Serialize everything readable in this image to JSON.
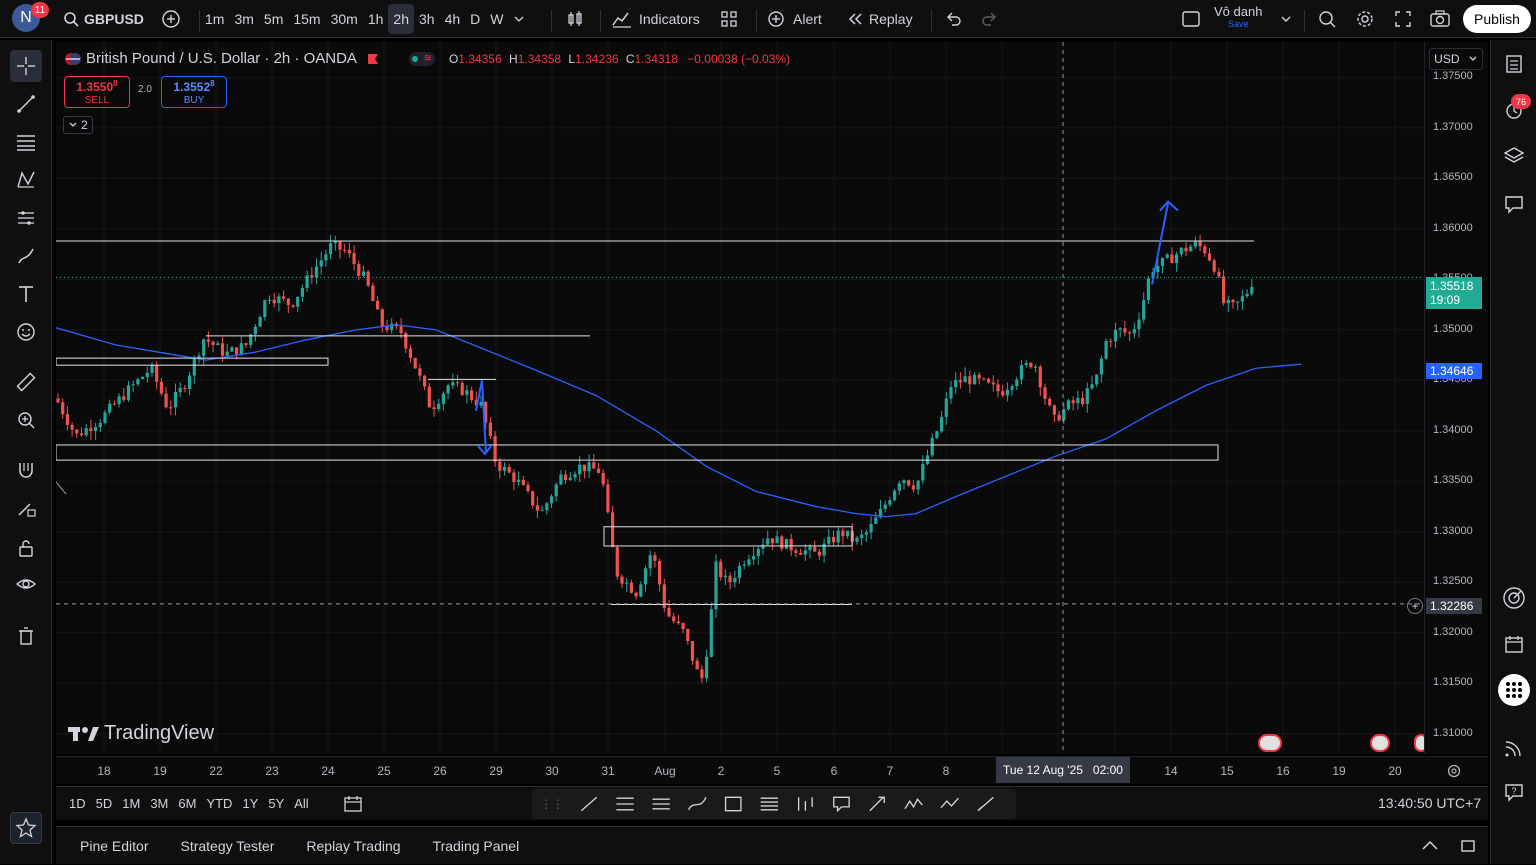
{
  "topbar": {
    "user_initial": "N",
    "notif_count": "11",
    "symbol": "GBPUSD",
    "intervals": [
      "1m",
      "3m",
      "5m",
      "15m",
      "30m",
      "1h",
      "2h",
      "3h",
      "4h",
      "D",
      "W"
    ],
    "active_interval": "2h",
    "indicators": "Indicators",
    "alert": "Alert",
    "replay": "Replay",
    "layout_name": "Vô danh",
    "layout_save": "Save",
    "publish": "Publish"
  },
  "legend": {
    "title": "British Pound / U.S. Dollar · 2h · OANDA",
    "o_label": "O",
    "o": "1.34356",
    "h_label": "H",
    "h": "1.34358",
    "l_label": "L",
    "l": "1.34236",
    "c_label": "C",
    "c": "1.34318",
    "change": "−0.00038 (−0.03%)",
    "sell_price": "1.3550",
    "sell_sup": "8",
    "sell_label": "SELL",
    "spread": "2.0",
    "buy_price": "1.3552",
    "buy_sup": "8",
    "buy_label": "BUY",
    "collapse": "2"
  },
  "price_scale": {
    "currency": "USD",
    "labels": [
      "1.37500",
      "1.37000",
      "1.36500",
      "1.36000",
      "1.35500",
      "1.35000",
      "1.34500",
      "1.34000",
      "1.33500",
      "1.33000",
      "1.32500",
      "1.32000",
      "1.31500",
      "1.31000"
    ],
    "last_price": "1.35518",
    "countdown": "19:09",
    "ma_price": "1.34646",
    "crosshair_price": "1.32286"
  },
  "time_scale": {
    "labels": [
      "18",
      "19",
      "22",
      "23",
      "24",
      "25",
      "26",
      "29",
      "30",
      "31",
      "Aug",
      "2",
      "5",
      "6",
      "7",
      "8",
      "14",
      "15",
      "16",
      "19",
      "20"
    ],
    "crosshair_time": "Tue 12 Aug '25   02:00"
  },
  "chart_data": {
    "type": "candlestick",
    "symbol": "GBPUSD",
    "interval": "2h",
    "y_range": [
      1.308,
      1.3785
    ],
    "moving_average_last": 1.34646,
    "last_price": 1.35518,
    "crosshair_price": 1.32286,
    "horizontal_zones": [
      [
        1.3588,
        1.3588
      ],
      [
        1.3472,
        1.3465
      ],
      [
        1.3494,
        1.3494
      ],
      [
        1.3386,
        1.3371
      ],
      [
        1.3305,
        1.3286
      ]
    ]
  },
  "watermark": "TradingView",
  "bottom": {
    "ranges": [
      "1D",
      "5D",
      "1M",
      "3M",
      "6M",
      "YTD",
      "1Y",
      "5Y",
      "All"
    ],
    "clock": "13:40:50 UTC+7"
  },
  "panels": [
    "Pine Editor",
    "Strategy Tester",
    "Replay Trading",
    "Trading Panel"
  ],
  "right_badge": "76",
  "colors": {
    "up": "#26a69a",
    "down": "#ef5350",
    "ma": "#2962ff",
    "accent": "#2962ff",
    "bg": "#0a0a0a"
  }
}
